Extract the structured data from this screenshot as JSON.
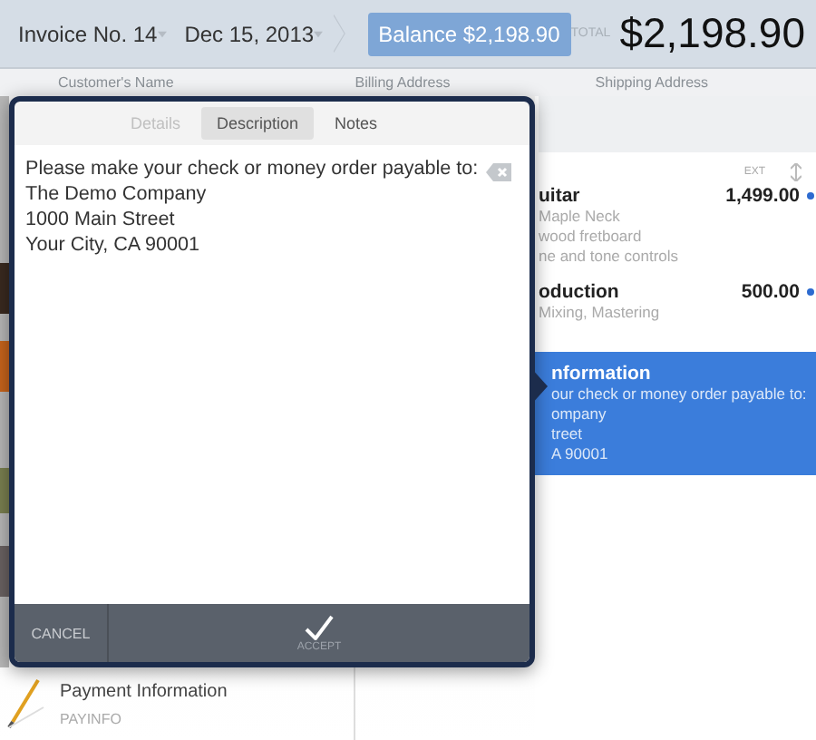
{
  "header": {
    "invoice": "Invoice No. 14",
    "date": "Dec 15, 2013",
    "balance": "Balance $2,198.90",
    "total_label": "TOTAL",
    "total": "$2,198.90"
  },
  "columns": [
    "Customer's Name",
    "Billing Address",
    "Shipping Address"
  ],
  "popover": {
    "tabs": [
      {
        "label": "Details",
        "selected": false,
        "disabled": true
      },
      {
        "label": "Description",
        "selected": true,
        "disabled": false
      },
      {
        "label": "Notes",
        "selected": false,
        "disabled": false
      }
    ],
    "value": "Please make your check or money order payable to:\nThe Demo Company\n1000 Main Street\nYour City, CA 90001",
    "cancel": "CANCEL",
    "accept": "ACCEPT"
  },
  "line_items": {
    "column": "EXT",
    "items": [
      {
        "name": "uitar",
        "details": [
          "Maple Neck",
          "wood fretboard",
          "ne and tone controls"
        ],
        "amount": "1,499.00",
        "selected": false
      },
      {
        "name": "oduction",
        "details": [
          "Mixing, Mastering"
        ],
        "amount": "500.00",
        "selected": false
      },
      {
        "name": "nformation",
        "details": [
          "our check or money order payable to:",
          "ompany",
          "treet",
          "A 90001"
        ],
        "selected": true
      }
    ]
  },
  "items": [
    {
      "title": "Payment Information",
      "code": "PAYINFO"
    }
  ]
}
